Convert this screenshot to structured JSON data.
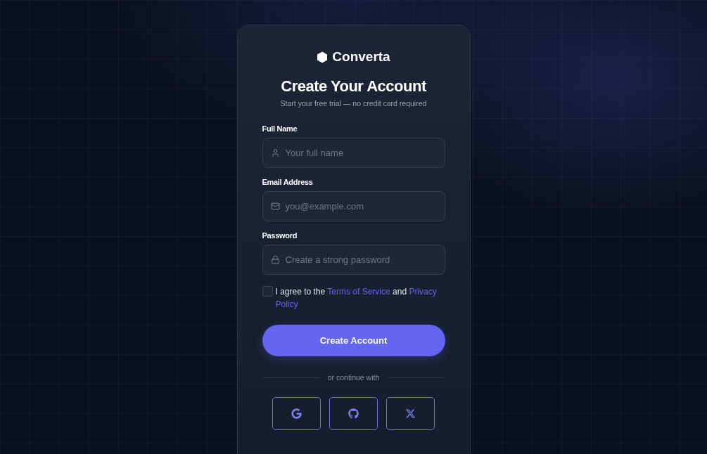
{
  "brand": {
    "name": "Converta"
  },
  "title": "Create Your Account",
  "subtitle": "Start your free trial — no credit card required",
  "fields": [
    {
      "kind": "user",
      "label": "Full Name",
      "placeholder": "Your full name"
    },
    {
      "kind": "mail",
      "label": "Email Address",
      "placeholder": "you@example.com"
    },
    {
      "kind": "lock",
      "label": "Password",
      "placeholder": "Create a strong password"
    }
  ],
  "agreement": {
    "checked": false,
    "parts": [
      {
        "kind": "text",
        "text": "I agree to the"
      },
      {
        "kind": "link",
        "text": "Terms of Service"
      },
      {
        "kind": "text",
        "text": "and"
      },
      {
        "kind": "link",
        "text": "Privacy"
      },
      {
        "kind": "link",
        "text": "Policy"
      }
    ]
  },
  "submit": "Create Account",
  "divider": "or continue with",
  "social": [
    {
      "kind": "google"
    },
    {
      "kind": "github"
    },
    {
      "kind": "x"
    }
  ]
}
